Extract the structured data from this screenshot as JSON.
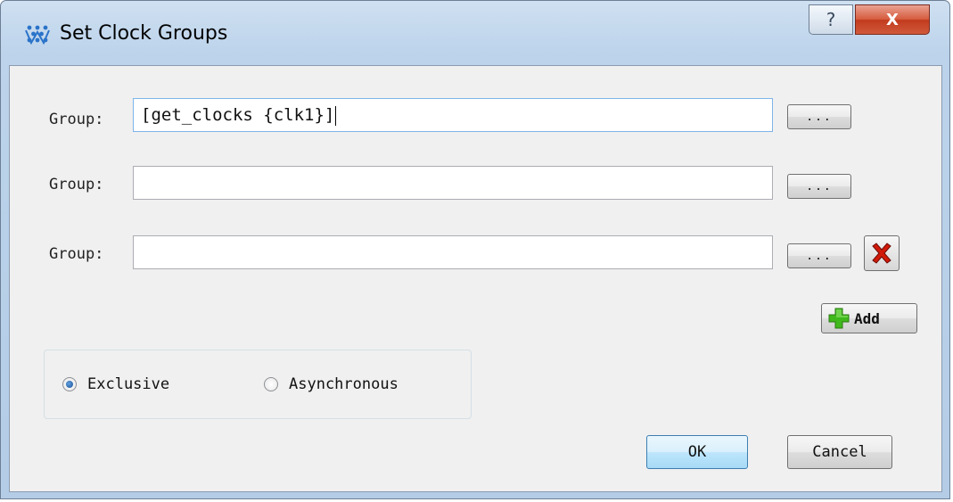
{
  "window": {
    "title": "Set Clock Groups"
  },
  "titlebar_buttons": {
    "help": "?",
    "close": "X"
  },
  "groups": [
    {
      "label": "Group:",
      "value": "[get_clocks {clk1}]",
      "browse": "...",
      "deletable": false
    },
    {
      "label": "Group:",
      "value": "",
      "browse": "...",
      "deletable": false
    },
    {
      "label": "Group:",
      "value": "",
      "browse": "...",
      "deletable": true
    }
  ],
  "add_button": {
    "label": "Add",
    "icon": "plus-icon"
  },
  "mode": {
    "options": [
      {
        "label": "Exclusive",
        "checked": true
      },
      {
        "label": "Asynchronous",
        "checked": false
      }
    ]
  },
  "footer": {
    "ok_label": "OK",
    "cancel_label": "Cancel"
  },
  "colors": {
    "title_bar": "#bcd3eb",
    "close_button": "#c23b1e",
    "ok_button": "#bee6fd",
    "delete_x": "#d11a0a",
    "add_plus": "#3fb81c"
  }
}
